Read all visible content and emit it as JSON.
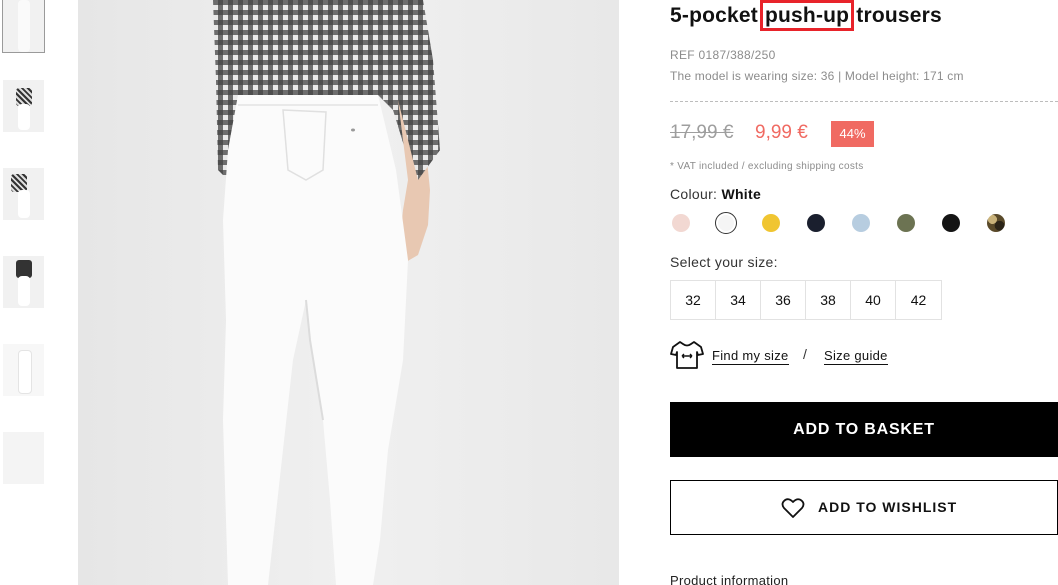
{
  "product": {
    "title_before": "5-pocket ",
    "title_highlight": "push-up",
    "title_after": " trousers",
    "ref": "REF 0187/388/250",
    "model_info": "The model is wearing size: 36 | Model height: 171 cm"
  },
  "price": {
    "old": "17,99 €",
    "new": "9,99 €",
    "discount": "44%",
    "vat_note": "* VAT included / excluding shipping costs"
  },
  "colour": {
    "label": "Colour:",
    "selected": "White",
    "swatches": [
      {
        "color": "#f2d8d2"
      },
      {
        "color": "#f5f5f5",
        "selected": true
      },
      {
        "color": "#f0c531"
      },
      {
        "color": "#1a1f2e"
      },
      {
        "color": "#b7cde0"
      },
      {
        "color": "#6c7352"
      },
      {
        "color": "#141414"
      },
      {
        "color": "#5a4a2a",
        "pattern": "camouflage"
      }
    ]
  },
  "sizes": {
    "label": "Select your size:",
    "options": [
      "32",
      "34",
      "36",
      "38",
      "40",
      "42"
    ]
  },
  "fit": {
    "icon": "tshirt-icon",
    "find_my_size": "Find my size",
    "separator": "/",
    "size_guide": "Size guide"
  },
  "actions": {
    "add_to_basket": "ADD TO BASKET",
    "add_to_wishlist": "ADD TO WISHLIST",
    "wishlist_icon": "heart-icon"
  },
  "sections": {
    "product_information": "Product information"
  },
  "thumbnails": [
    {
      "name": "pants-closeup",
      "active": true
    },
    {
      "name": "full-look-front"
    },
    {
      "name": "full-look-checked-shirt"
    },
    {
      "name": "full-look-dark-top"
    },
    {
      "name": "flat-lay"
    },
    {
      "name": "detail"
    }
  ],
  "colors": {
    "highlight_box": "#e8232a",
    "sale_price": "#f06a62",
    "button_primary": "#000000"
  }
}
